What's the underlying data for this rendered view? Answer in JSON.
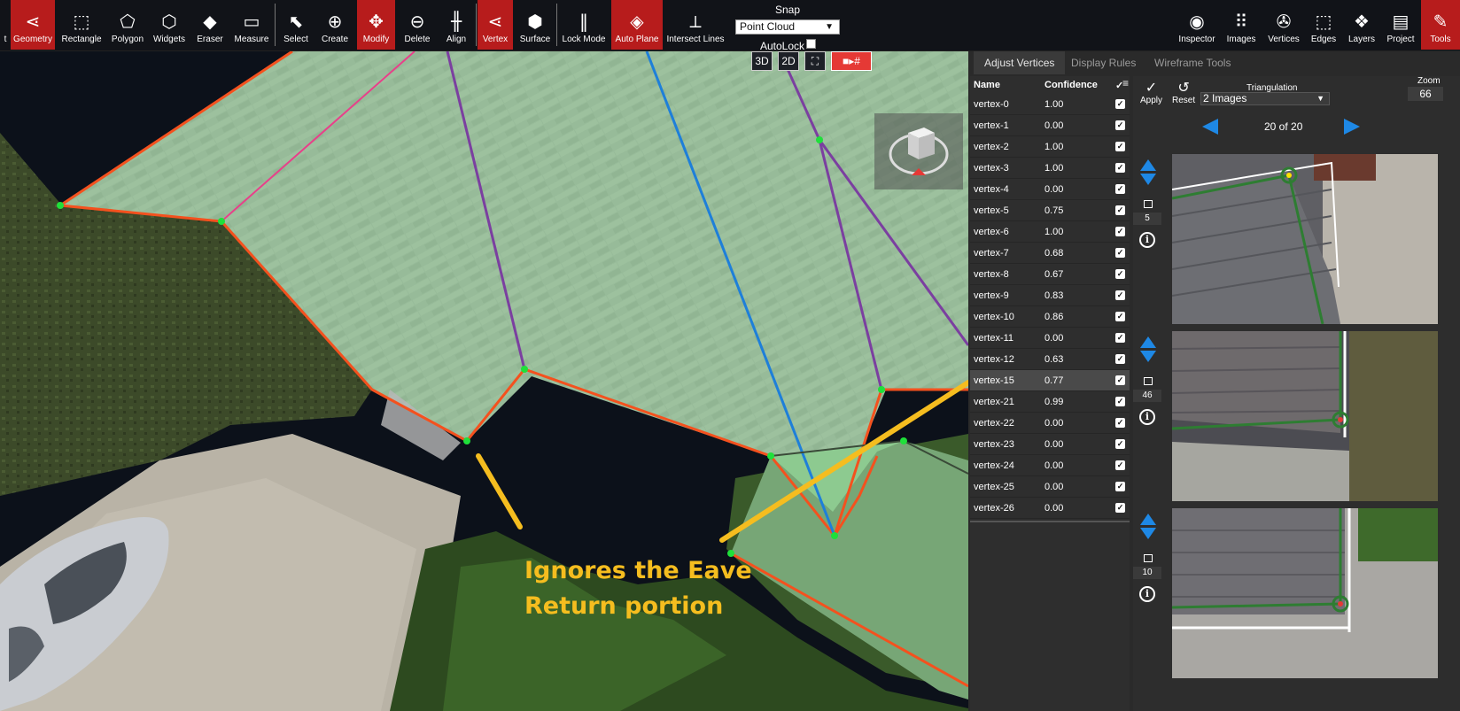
{
  "toolbar": {
    "items": [
      {
        "label": "t",
        "icon": "cut-off-icon"
      },
      {
        "label": "Geometry",
        "icon": "share-icon"
      },
      {
        "label": "Rectangle",
        "icon": "rectangle-icon"
      },
      {
        "label": "Polygon",
        "icon": "polygon-icon"
      },
      {
        "label": "Widgets",
        "icon": "widgets-icon"
      },
      {
        "label": "Eraser",
        "icon": "eraser-icon"
      },
      {
        "label": "Measure",
        "icon": "ruler-icon"
      },
      {
        "label": "Select",
        "icon": "cursor-icon"
      },
      {
        "label": "Create",
        "icon": "plus-circle-icon"
      },
      {
        "label": "Modify",
        "icon": "move-icon"
      },
      {
        "label": "Delete",
        "icon": "minus-circle-icon"
      },
      {
        "label": "Align",
        "icon": "align-icon"
      },
      {
        "label": "Vertex",
        "icon": "share-icon"
      },
      {
        "label": "Surface",
        "icon": "cube-icon"
      },
      {
        "label": "Lock Mode",
        "icon": "lock-mode-icon"
      },
      {
        "label": "Auto Plane",
        "icon": "auto-plane-icon"
      },
      {
        "label": "Intersect Lines",
        "icon": "intersect-icon"
      }
    ],
    "right_items": [
      {
        "label": "Inspector",
        "icon": "eye-icon"
      },
      {
        "label": "Images",
        "icon": "grid-icon"
      },
      {
        "label": "Vertices",
        "icon": "vertices-icon"
      },
      {
        "label": "Edges",
        "icon": "edges-icon"
      },
      {
        "label": "Layers",
        "icon": "layers-icon"
      },
      {
        "label": "Project",
        "icon": "clipboard-icon"
      },
      {
        "label": "Tools",
        "icon": "wrench-icon"
      }
    ],
    "snap_label": "Snap",
    "snap_value": "Point Cloud",
    "autolock_label": "AutoLock",
    "view_3d": "3D",
    "view_2d": "2D"
  },
  "panel": {
    "tabs": [
      "Adjust Vertices",
      "Display Rules",
      "Wireframe Tools"
    ],
    "table_headers": {
      "name": "Name",
      "confidence": "Confidence",
      "check": "✓"
    },
    "vertices": [
      {
        "name": "vertex-0",
        "confidence": "1.00"
      },
      {
        "name": "vertex-1",
        "confidence": "0.00"
      },
      {
        "name": "vertex-2",
        "confidence": "1.00"
      },
      {
        "name": "vertex-3",
        "confidence": "1.00"
      },
      {
        "name": "vertex-4",
        "confidence": "0.00"
      },
      {
        "name": "vertex-5",
        "confidence": "0.75"
      },
      {
        "name": "vertex-6",
        "confidence": "1.00"
      },
      {
        "name": "vertex-7",
        "confidence": "0.68"
      },
      {
        "name": "vertex-8",
        "confidence": "0.67"
      },
      {
        "name": "vertex-9",
        "confidence": "0.83"
      },
      {
        "name": "vertex-10",
        "confidence": "0.86"
      },
      {
        "name": "vertex-11",
        "confidence": "0.00"
      },
      {
        "name": "vertex-12",
        "confidence": "0.63"
      },
      {
        "name": "vertex-15",
        "confidence": "0.77"
      },
      {
        "name": "vertex-21",
        "confidence": "0.99"
      },
      {
        "name": "vertex-22",
        "confidence": "0.00"
      },
      {
        "name": "vertex-23",
        "confidence": "0.00"
      },
      {
        "name": "vertex-24",
        "confidence": "0.00"
      },
      {
        "name": "vertex-25",
        "confidence": "0.00"
      },
      {
        "name": "vertex-26",
        "confidence": "0.00"
      }
    ],
    "apply_label": "Apply",
    "reset_label": "Reset",
    "triangulation_label": "Triangulation",
    "triangulation_value": "2 Images",
    "zoom_label": "Zoom",
    "zoom_value": "66",
    "page_counter": "20 of 20",
    "image_numbers": [
      "5",
      "46",
      "10"
    ]
  },
  "annotation": {
    "line1": "Ignores the Eave",
    "line2": "Return portion"
  },
  "colors": {
    "accent_red": "#b71c1c",
    "annotation_yellow": "#f5bd1f",
    "nav_blue": "#1e88e5",
    "roof_green": "#8fc79a",
    "edge_orange": "#f4511e",
    "ridge_purple": "#7b3fa0",
    "valley_blue": "#1e7fd9",
    "hip_pink": "#e8408a"
  }
}
